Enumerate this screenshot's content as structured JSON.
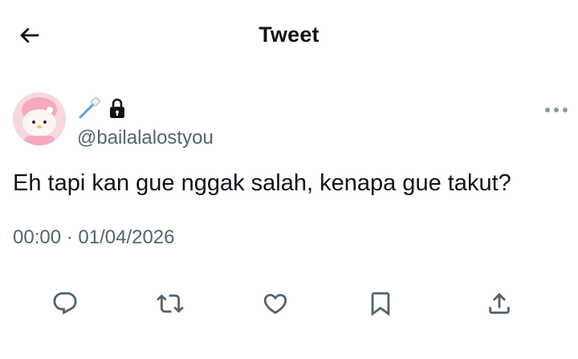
{
  "header": {
    "title": "Tweet",
    "back_icon": "arrow-left-icon"
  },
  "tweet": {
    "display_name_emojis": [
      "toothbrush-emoji",
      "lock-icon"
    ],
    "handle": "@bailalalostyou",
    "text": "Eh tapi kan gue nggak salah, kenapa gue takut?",
    "timestamp": "00:00 · 01/04/2026",
    "more_icon": "more-horizontal-icon"
  },
  "actions": [
    {
      "name": "reply",
      "icon": "reply-icon"
    },
    {
      "name": "retweet",
      "icon": "retweet-icon"
    },
    {
      "name": "like",
      "icon": "heart-icon"
    },
    {
      "name": "bookmark",
      "icon": "bookmark-icon"
    },
    {
      "name": "share",
      "icon": "share-icon"
    }
  ],
  "colors": {
    "text_primary": "#0f1419",
    "text_secondary": "#536471",
    "icon_gray": "#536471",
    "background": "#ffffff"
  }
}
